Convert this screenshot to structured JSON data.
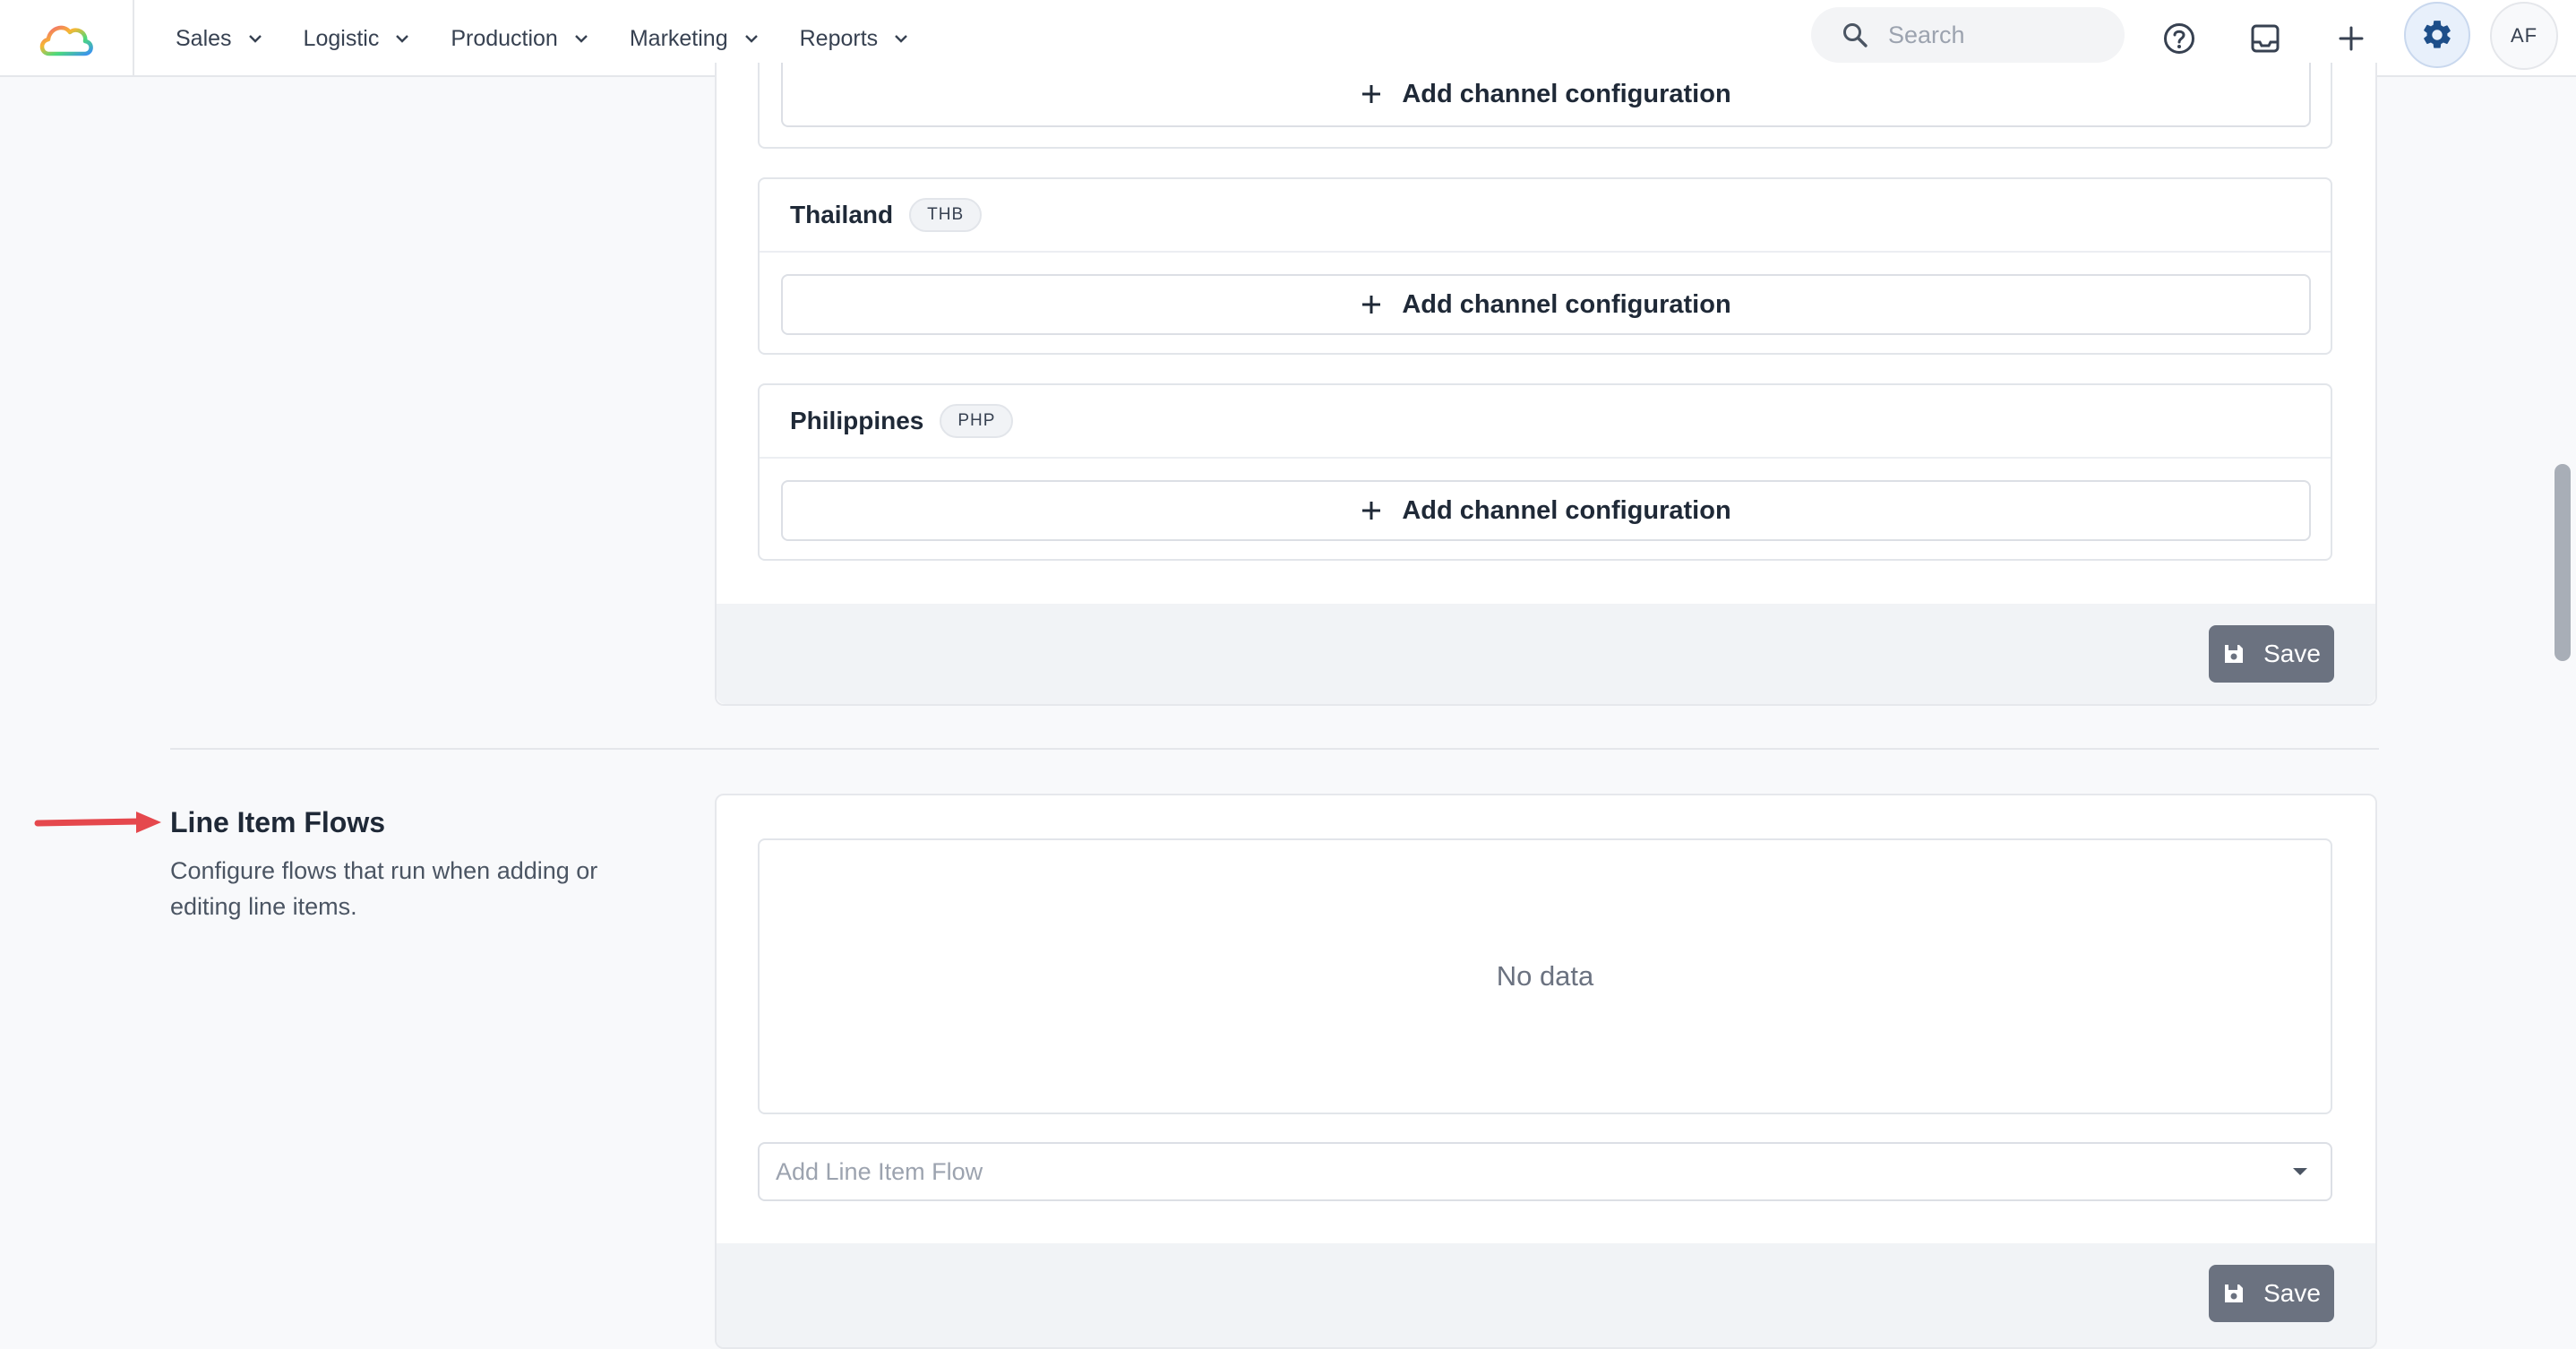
{
  "header": {
    "nav": [
      {
        "label": "Sales"
      },
      {
        "label": "Logistic"
      },
      {
        "label": "Production"
      },
      {
        "label": "Marketing"
      },
      {
        "label": "Reports"
      }
    ],
    "search_placeholder": "Search",
    "avatar_initials": "AF"
  },
  "currencies": {
    "add_config_label": "Add channel configuration",
    "countries": [
      {
        "name": "Thailand",
        "currency": "THB"
      },
      {
        "name": "Philippines",
        "currency": "PHP"
      }
    ],
    "save_label": "Save"
  },
  "line_item_flows": {
    "title": "Line Item Flows",
    "description": "Configure flows that run when adding or editing line items.",
    "empty_text": "No data",
    "select_placeholder": "Add Line Item Flow",
    "save_label": "Save"
  },
  "colors": {
    "accent": "#1d4e89",
    "save_button": "#6b7280",
    "annotation_arrow": "#e5484d"
  }
}
